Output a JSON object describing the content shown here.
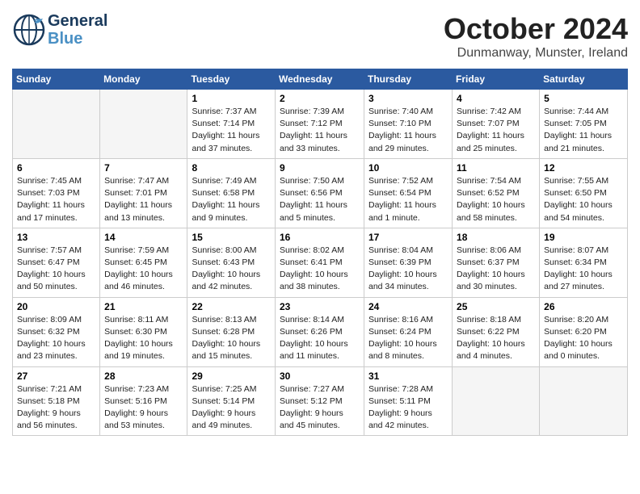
{
  "header": {
    "logo_line1": "General",
    "logo_line2": "Blue",
    "month": "October 2024",
    "location": "Dunmanway, Munster, Ireland"
  },
  "weekdays": [
    "Sunday",
    "Monday",
    "Tuesday",
    "Wednesday",
    "Thursday",
    "Friday",
    "Saturday"
  ],
  "weeks": [
    [
      {
        "day": "",
        "info": ""
      },
      {
        "day": "",
        "info": ""
      },
      {
        "day": "1",
        "info": "Sunrise: 7:37 AM\nSunset: 7:14 PM\nDaylight: 11 hours\nand 37 minutes."
      },
      {
        "day": "2",
        "info": "Sunrise: 7:39 AM\nSunset: 7:12 PM\nDaylight: 11 hours\nand 33 minutes."
      },
      {
        "day": "3",
        "info": "Sunrise: 7:40 AM\nSunset: 7:10 PM\nDaylight: 11 hours\nand 29 minutes."
      },
      {
        "day": "4",
        "info": "Sunrise: 7:42 AM\nSunset: 7:07 PM\nDaylight: 11 hours\nand 25 minutes."
      },
      {
        "day": "5",
        "info": "Sunrise: 7:44 AM\nSunset: 7:05 PM\nDaylight: 11 hours\nand 21 minutes."
      }
    ],
    [
      {
        "day": "6",
        "info": "Sunrise: 7:45 AM\nSunset: 7:03 PM\nDaylight: 11 hours\nand 17 minutes."
      },
      {
        "day": "7",
        "info": "Sunrise: 7:47 AM\nSunset: 7:01 PM\nDaylight: 11 hours\nand 13 minutes."
      },
      {
        "day": "8",
        "info": "Sunrise: 7:49 AM\nSunset: 6:58 PM\nDaylight: 11 hours\nand 9 minutes."
      },
      {
        "day": "9",
        "info": "Sunrise: 7:50 AM\nSunset: 6:56 PM\nDaylight: 11 hours\nand 5 minutes."
      },
      {
        "day": "10",
        "info": "Sunrise: 7:52 AM\nSunset: 6:54 PM\nDaylight: 11 hours\nand 1 minute."
      },
      {
        "day": "11",
        "info": "Sunrise: 7:54 AM\nSunset: 6:52 PM\nDaylight: 10 hours\nand 58 minutes."
      },
      {
        "day": "12",
        "info": "Sunrise: 7:55 AM\nSunset: 6:50 PM\nDaylight: 10 hours\nand 54 minutes."
      }
    ],
    [
      {
        "day": "13",
        "info": "Sunrise: 7:57 AM\nSunset: 6:47 PM\nDaylight: 10 hours\nand 50 minutes."
      },
      {
        "day": "14",
        "info": "Sunrise: 7:59 AM\nSunset: 6:45 PM\nDaylight: 10 hours\nand 46 minutes."
      },
      {
        "day": "15",
        "info": "Sunrise: 8:00 AM\nSunset: 6:43 PM\nDaylight: 10 hours\nand 42 minutes."
      },
      {
        "day": "16",
        "info": "Sunrise: 8:02 AM\nSunset: 6:41 PM\nDaylight: 10 hours\nand 38 minutes."
      },
      {
        "day": "17",
        "info": "Sunrise: 8:04 AM\nSunset: 6:39 PM\nDaylight: 10 hours\nand 34 minutes."
      },
      {
        "day": "18",
        "info": "Sunrise: 8:06 AM\nSunset: 6:37 PM\nDaylight: 10 hours\nand 30 minutes."
      },
      {
        "day": "19",
        "info": "Sunrise: 8:07 AM\nSunset: 6:34 PM\nDaylight: 10 hours\nand 27 minutes."
      }
    ],
    [
      {
        "day": "20",
        "info": "Sunrise: 8:09 AM\nSunset: 6:32 PM\nDaylight: 10 hours\nand 23 minutes."
      },
      {
        "day": "21",
        "info": "Sunrise: 8:11 AM\nSunset: 6:30 PM\nDaylight: 10 hours\nand 19 minutes."
      },
      {
        "day": "22",
        "info": "Sunrise: 8:13 AM\nSunset: 6:28 PM\nDaylight: 10 hours\nand 15 minutes."
      },
      {
        "day": "23",
        "info": "Sunrise: 8:14 AM\nSunset: 6:26 PM\nDaylight: 10 hours\nand 11 minutes."
      },
      {
        "day": "24",
        "info": "Sunrise: 8:16 AM\nSunset: 6:24 PM\nDaylight: 10 hours\nand 8 minutes."
      },
      {
        "day": "25",
        "info": "Sunrise: 8:18 AM\nSunset: 6:22 PM\nDaylight: 10 hours\nand 4 minutes."
      },
      {
        "day": "26",
        "info": "Sunrise: 8:20 AM\nSunset: 6:20 PM\nDaylight: 10 hours\nand 0 minutes."
      }
    ],
    [
      {
        "day": "27",
        "info": "Sunrise: 7:21 AM\nSunset: 5:18 PM\nDaylight: 9 hours\nand 56 minutes."
      },
      {
        "day": "28",
        "info": "Sunrise: 7:23 AM\nSunset: 5:16 PM\nDaylight: 9 hours\nand 53 minutes."
      },
      {
        "day": "29",
        "info": "Sunrise: 7:25 AM\nSunset: 5:14 PM\nDaylight: 9 hours\nand 49 minutes."
      },
      {
        "day": "30",
        "info": "Sunrise: 7:27 AM\nSunset: 5:12 PM\nDaylight: 9 hours\nand 45 minutes."
      },
      {
        "day": "31",
        "info": "Sunrise: 7:28 AM\nSunset: 5:11 PM\nDaylight: 9 hours\nand 42 minutes."
      },
      {
        "day": "",
        "info": ""
      },
      {
        "day": "",
        "info": ""
      }
    ]
  ]
}
